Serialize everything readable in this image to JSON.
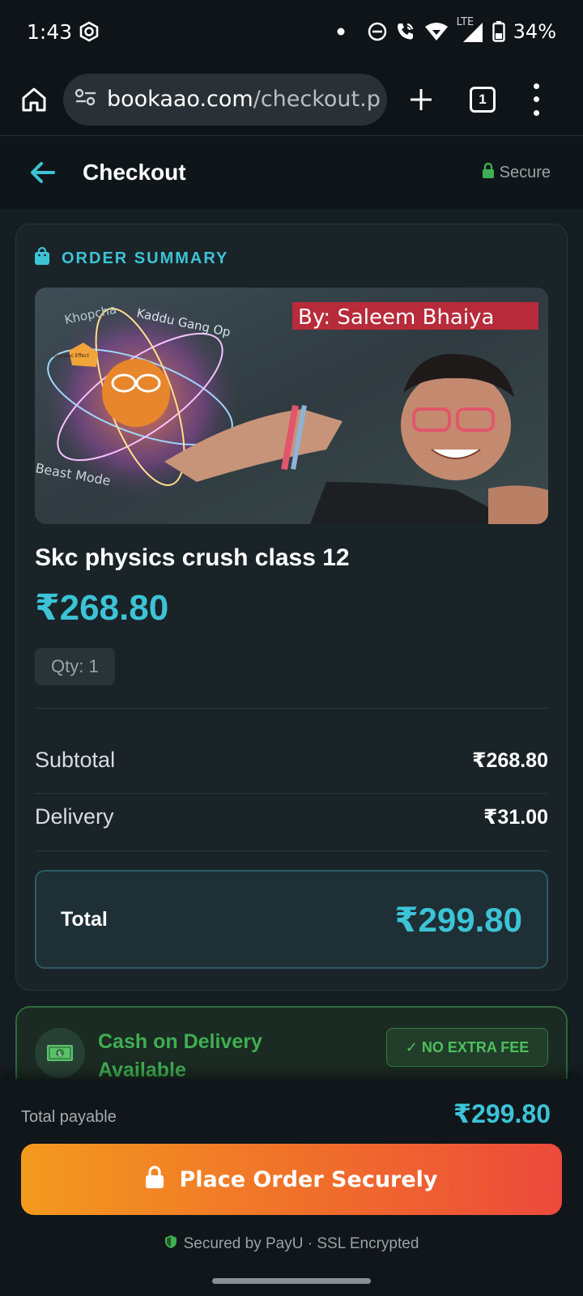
{
  "status_bar": {
    "time": "1:43",
    "battery": "34%",
    "network": "LTE"
  },
  "browser": {
    "url_host": "bookaao.com",
    "url_path": "/checkout.p",
    "tab_count": "1"
  },
  "header": {
    "title": "Checkout",
    "secure_label": "Secure"
  },
  "order_summary": {
    "heading": "ORDER SUMMARY",
    "image_caption": "By: Saleem Bhaiya",
    "image_texts": [
      "Khopcha",
      "Kaddu Gang Op",
      "Beast Mode",
      "Sonnenc Effect"
    ],
    "product_name": "Skc physics crush class 12",
    "price": "₹268.80",
    "qty": "Qty: 1",
    "subtotal_label": "Subtotal",
    "subtotal_value": "₹268.80",
    "delivery_label": "Delivery",
    "delivery_value": "₹31.00",
    "total_label": "Total",
    "total_value": "₹299.80"
  },
  "cod": {
    "text": "Cash on Delivery Available",
    "badge": "✓ NO EXTRA FEE"
  },
  "checkout_bar": {
    "payable_label": "Total payable",
    "payable_value": "₹299.80",
    "button_label": "Place Order Securely",
    "secured_note": "Secured by PayU · SSL Encrypted"
  },
  "colors": {
    "accent": "#3cc3d6",
    "success": "#3fae52",
    "button_start": "#f39a1e",
    "button_end": "#ec4a3c",
    "background": "#141d21"
  }
}
